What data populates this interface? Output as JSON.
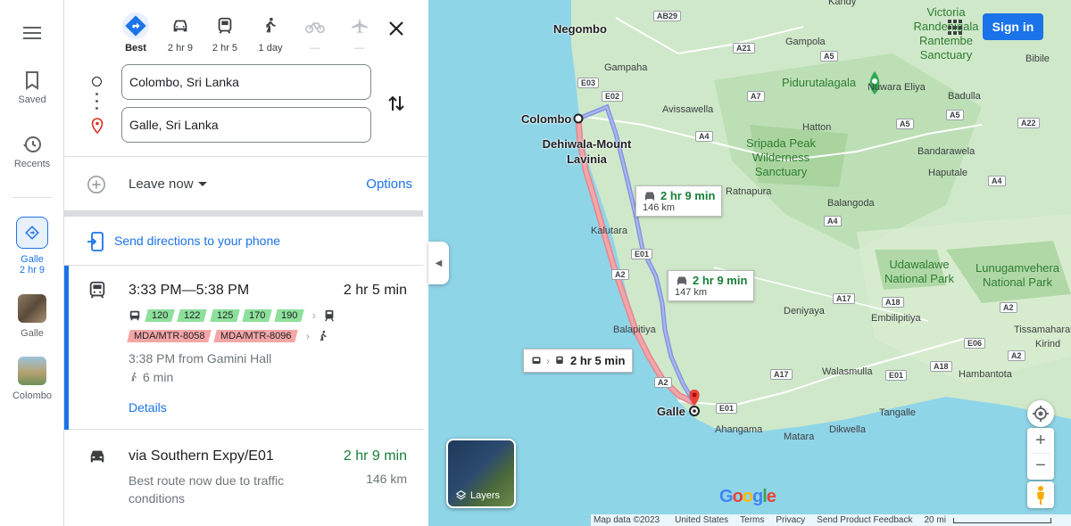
{
  "sidebar": {
    "menu_icon": "menu-icon",
    "saved_label": "Saved",
    "recents_label": "Recents",
    "active_dest_label": "Galle",
    "active_dest_time": "2 hr 9",
    "history": [
      {
        "label": "Galle"
      },
      {
        "label": "Colombo"
      }
    ]
  },
  "modes": [
    {
      "icon": "directions-icon",
      "label": "Best",
      "active": true
    },
    {
      "icon": "car-icon",
      "label": "2 hr 9"
    },
    {
      "icon": "transit-icon",
      "label": "2 hr 5"
    },
    {
      "icon": "walk-icon",
      "label": "1 day"
    },
    {
      "icon": "bike-icon",
      "label": "—",
      "disabled": true
    },
    {
      "icon": "flight-icon",
      "label": "—",
      "disabled": true
    }
  ],
  "origin": {
    "value": "Colombo, Sri Lanka"
  },
  "destination": {
    "value": "Galle, Sri Lanka"
  },
  "leave": {
    "label": "Leave now",
    "options_label": "Options"
  },
  "send_label": "Send directions to your phone",
  "transit_route": {
    "times": "3:33 PM—5:38 PM",
    "duration": "2 hr 5 min",
    "bus_lines": [
      "120",
      "122",
      "125",
      "170",
      "190"
    ],
    "rail_lines": [
      "MDA/MTR-8058",
      "MDA/MTR-8096"
    ],
    "from": "3:38 PM from Gamini Hall",
    "walk": "6 min",
    "details_label": "Details"
  },
  "drive_route": {
    "via": "via Southern Expy/E01",
    "duration": "2 hr 9 min",
    "description": "Best route now due to traffic conditions",
    "distance": "146 km"
  },
  "map": {
    "sign_in": "Sign in",
    "callouts": {
      "drive1_time": "2 hr 9 min",
      "drive1_km": "146 km",
      "drive2_time": "2 hr 9 min",
      "drive2_km": "147 km",
      "transit_time": "2 hr 5 min"
    },
    "cities": {
      "negombo": "Negombo",
      "colombo": "Colombo",
      "dehiwala": "Dehiwala-Mount Lavinia",
      "galle": "Galle"
    },
    "parks": {
      "sripada": "Sripada Peak Wilderness Sanctuary",
      "victoria": "Victoria Randenigala Rantembe Sanctuary",
      "udawalawe": "Udawalawe National Park",
      "lunugamvehera": "Lunugamvehera National Park",
      "pidurutalagala": "Pidurutalagala"
    },
    "places": {
      "kandy": "Kandy",
      "gampola": "Gampola",
      "gampaha": "Gampaha",
      "avissawella": "Avissawella",
      "hatton": "Hatton",
      "nuwara": "Nuwara Eliya",
      "badulla": "Badulla",
      "bibile": "Bibile",
      "bandarawela": "Bandarawela",
      "haputale": "Haputale",
      "ratnapura": "Ratnapura",
      "balangoda": "Balangoda",
      "kalutara": "Kalutara",
      "deniyaya": "Deniyaya",
      "embilipitiya": "Embilipitiya",
      "balapitiya": "Balapitiya",
      "walasmulla": "Walasmulla",
      "hambantota": "Hambantota",
      "tissamaharama": "Tissamaharar",
      "kirinda": "Kirind",
      "tangalle": "Tangalle",
      "ahangama": "Ahangama",
      "matara": "Matara",
      "dikwella": "Dikwella"
    },
    "layers_label": "Layers",
    "footer": {
      "mapdata": "Map data ©2023",
      "country": "United States",
      "terms": "Terms",
      "privacy": "Privacy",
      "feedback": "Send Product Feedback",
      "scale": "20 mi"
    },
    "zoom_in": "+",
    "zoom_out": "−"
  }
}
